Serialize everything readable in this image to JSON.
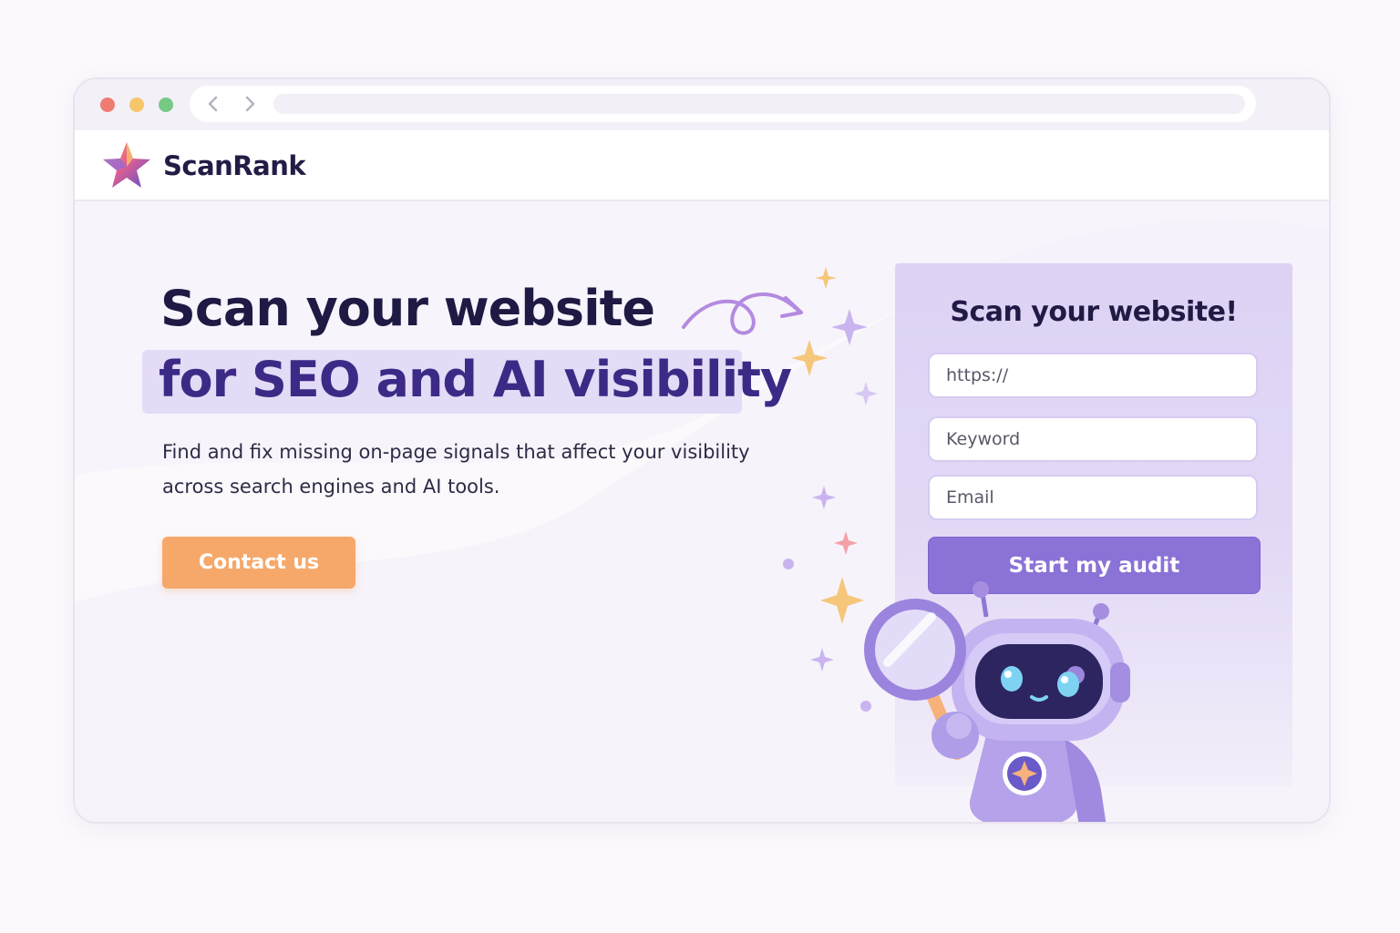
{
  "brand": {
    "name": "ScanRank"
  },
  "hero": {
    "headline_line1": "Scan your website",
    "headline_line2": "for SEO and AI visibility",
    "subtext": "Find and fix missing on-page signals that affect your visibility across search engines and AI tools.",
    "cta_label": "Contact us"
  },
  "form": {
    "title": "Scan your website!",
    "url_placeholder": "https://",
    "keyword_placeholder": "Keyword",
    "email_placeholder": "Email",
    "submit_label": "Start my audit"
  },
  "icons": {
    "back": "chevron-left-icon",
    "forward": "chevron-right-icon",
    "logo": "star-logo-icon",
    "arrow": "curly-arrow-icon",
    "robot": "robot-with-magnifier-icon"
  },
  "colors": {
    "primary": "#8b72d6",
    "accent": "#f6a86a",
    "heading": "#1f1a44",
    "highlight_text": "#3d2a86",
    "panel": "#ddd2f4"
  }
}
